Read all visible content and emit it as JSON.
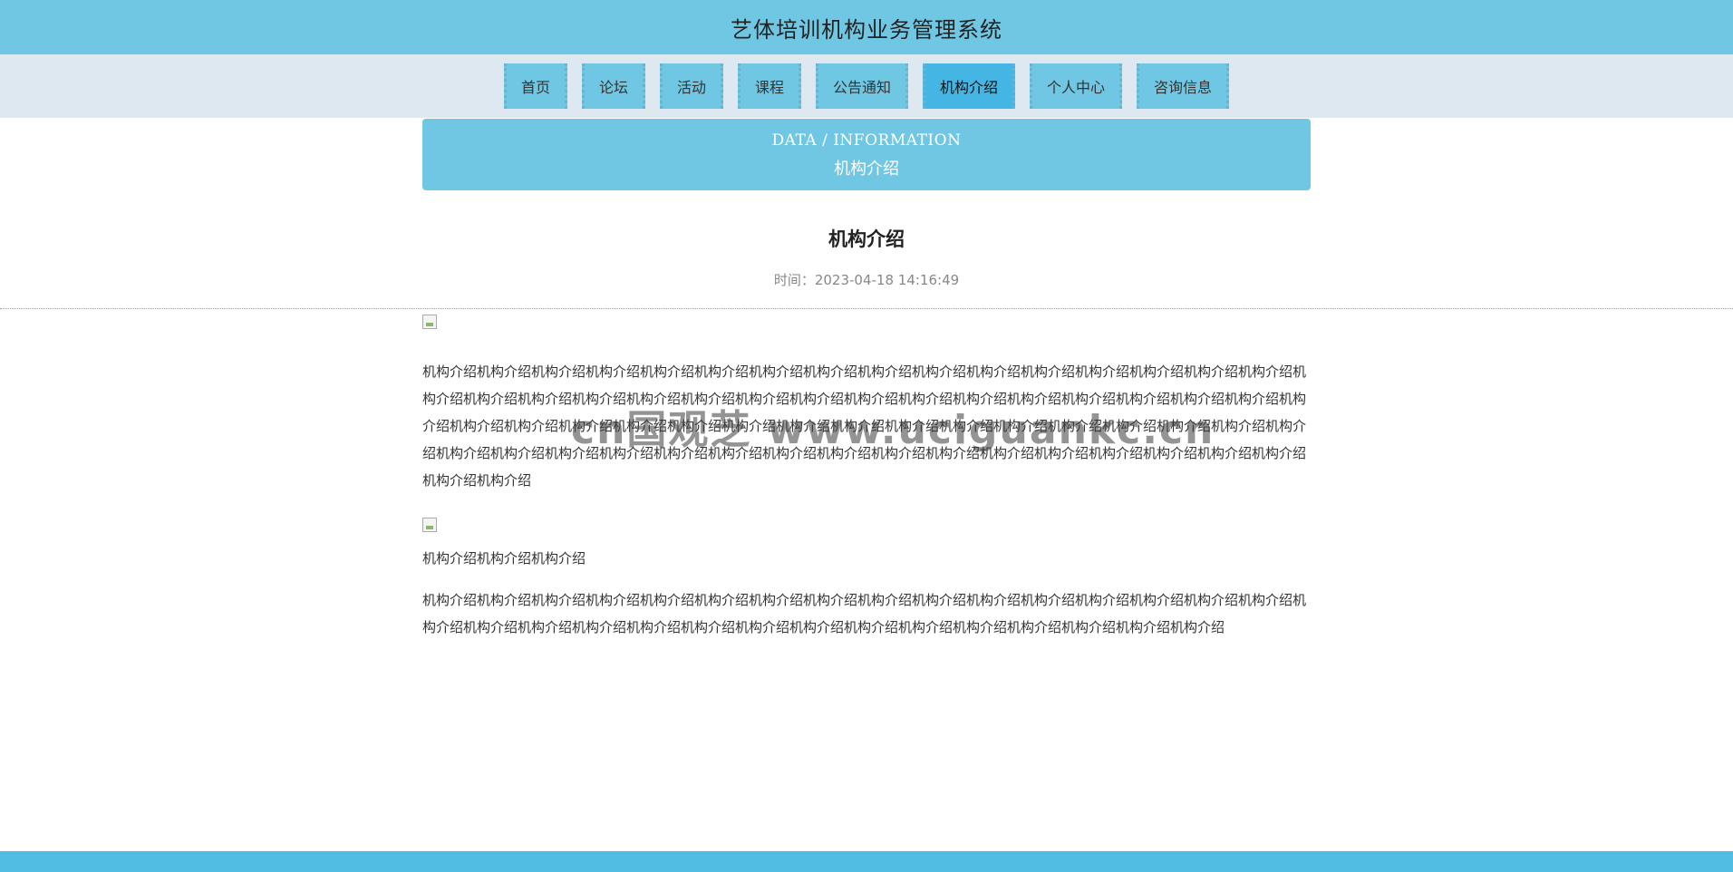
{
  "header": {
    "title": "艺体培训机构业务管理系统"
  },
  "nav": {
    "items": [
      {
        "label": "首页"
      },
      {
        "label": "论坛"
      },
      {
        "label": "活动"
      },
      {
        "label": "课程"
      },
      {
        "label": "公告通知"
      },
      {
        "label": "机构介绍"
      },
      {
        "label": "个人中心"
      },
      {
        "label": "咨询信息"
      }
    ],
    "active": "机构介绍"
  },
  "banner": {
    "en": "DATA / INFORMATION",
    "cn": "机构介绍"
  },
  "article": {
    "title": "机构介绍",
    "time": "时间：2023-04-18 14:16:49",
    "paragraph1": "机构介绍机构介绍机构介绍机构介绍机构介绍机构介绍机构介绍机构介绍机构介绍机构介绍机构介绍机构介绍机构介绍机构介绍机构介绍机构介绍机构介绍机构介绍机构介绍机构介绍机构介绍机构介绍机构介绍机构介绍机构介绍机构介绍机构介绍机构介绍机构介绍机构介绍机构介绍机构介绍机构介绍机构介绍机构介绍机构介绍机构介绍机构介绍机构介绍机构介绍机构介绍机构介绍机构介绍机构介绍机构介绍机构介绍机构介绍机构介绍机构介绍机构介绍机构介绍机构介绍机构介绍机构介绍机构介绍机构介绍机构介绍机构介绍机构介绍机构介绍机构介绍机构介绍机构介绍机构介绍机构介绍机构介绍机构介绍",
    "paragraph2": "机构介绍机构介绍机构介绍",
    "paragraph3": "机构介绍机构介绍机构介绍机构介绍机构介绍机构介绍机构介绍机构介绍机构介绍机构介绍机构介绍机构介绍机构介绍机构介绍机构介绍机构介绍机构介绍机构介绍机构介绍机构介绍机构介绍机构介绍机构介绍机构介绍机构介绍机构介绍机构介绍机构介绍机构介绍机构介绍机构介绍"
  },
  "watermark": "cn国观芝 www.uciguankc.cn",
  "colors": {
    "primary": "#70c7e3",
    "active": "#45b6e4",
    "navbg": "#dde8f0",
    "footer": "#52bde3"
  }
}
